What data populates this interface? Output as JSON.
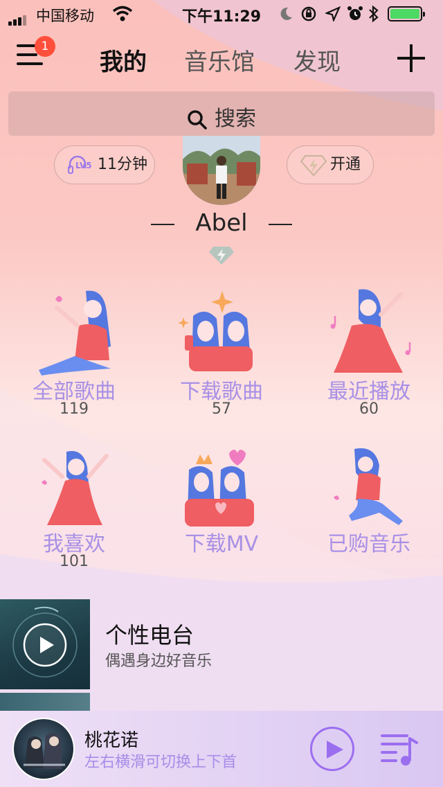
{
  "status_bar": {
    "carrier": "中国移动",
    "time": "下午11:29"
  },
  "header": {
    "notification_count": "1",
    "tabs": [
      {
        "label": "我的",
        "active": true
      },
      {
        "label": "音乐馆",
        "active": false
      },
      {
        "label": "发现",
        "active": false
      }
    ]
  },
  "search": {
    "placeholder": "搜索"
  },
  "profile": {
    "level_badge": "LV5",
    "listen_time": "11分钟",
    "vip_label": "开通",
    "username": "Abel"
  },
  "grid": [
    {
      "label": "全部歌曲",
      "count": "119"
    },
    {
      "label": "下载歌曲",
      "count": "57"
    },
    {
      "label": "最近播放",
      "count": "60"
    },
    {
      "label": "我喜欢",
      "count": "101"
    },
    {
      "label": "下载MV",
      "count": ""
    },
    {
      "label": "已购音乐",
      "count": ""
    }
  ],
  "radio": {
    "title": "个性电台",
    "subtitle": "偶遇身边好音乐"
  },
  "player": {
    "song": "桃花诺",
    "hint": "左右横滑可切换上下首"
  },
  "colors": {
    "accent": "#a890e6",
    "badge": "#ff4e3a",
    "battery": "#4cd964"
  }
}
